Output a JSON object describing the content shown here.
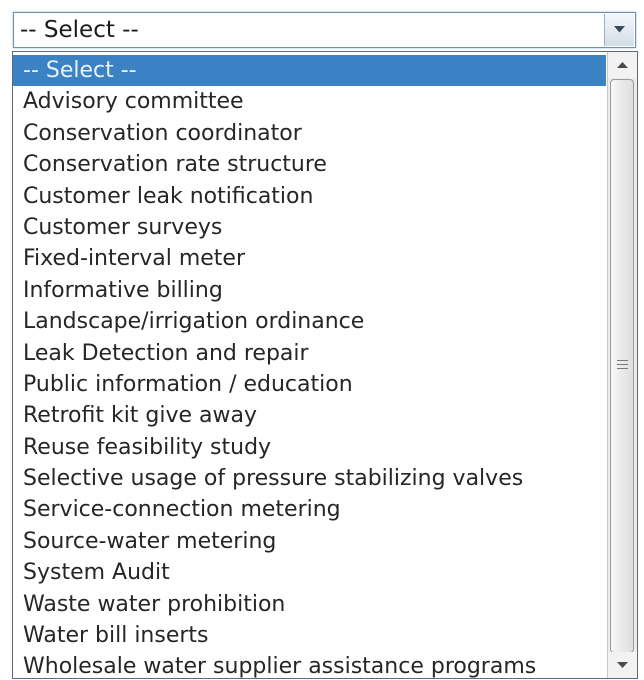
{
  "select": {
    "value": "-- Select --",
    "arrow_icon": "chevron-down-icon"
  },
  "dropdown": {
    "options": [
      "-- Select --",
      "Advisory committee",
      "Conservation coordinator",
      "Conservation rate structure",
      "Customer leak notification",
      "Customer surveys",
      "Fixed-interval meter",
      "Informative billing",
      "Landscape/irrigation ordinance",
      "Leak Detection and repair",
      "Public information / education",
      "Retrofit kit give away",
      "Reuse feasibility study",
      "Selective usage of pressure stabilizing valves",
      "Service-connection metering",
      "Source-water metering",
      "System Audit",
      "Waste water prohibition",
      "Water bill inserts",
      "Wholesale water supplier assistance programs"
    ],
    "selected_index": 0
  },
  "colors": {
    "highlight": "#3b82c4",
    "highlight_text": "#e9f1fa",
    "text": "#262626",
    "border": "#5b6b7b"
  }
}
